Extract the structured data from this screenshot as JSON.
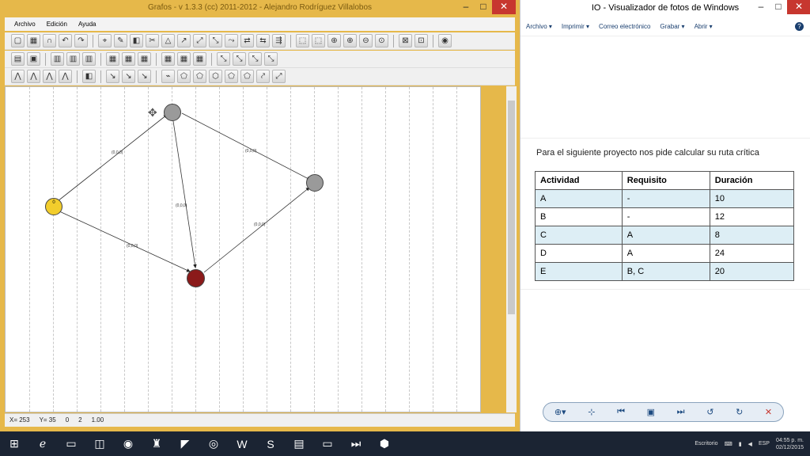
{
  "graphs_window": {
    "title": "Grafos - v 1.3.3 (cc) 2011-2012 - Alejandro Rodríguez Villalobos",
    "menu": [
      "Archivo",
      "Edición",
      "Ayuda"
    ],
    "status": {
      "x": "X= 253",
      "y": "Y= 35",
      "edges": "0",
      "count": "2",
      "zoom": "1.00"
    },
    "nodes": [
      {
        "label": "0",
        "color": "#f2cd2c"
      },
      {
        "label": "",
        "color": "#9a9a9a"
      },
      {
        "label": "",
        "color": "#9a9a9a"
      },
      {
        "label": "",
        "color": "#8b1a1a"
      }
    ],
    "edge_labels": [
      "(0,0,0)",
      "(0,0,0)",
      "(0,0,0)",
      "(0,0,0)",
      "(0,0,0)"
    ]
  },
  "viewer_window": {
    "title": "IO - Visualizador de fotos de Windows",
    "menu": [
      "Archivo ▾",
      "Imprimir ▾",
      "Correo electrónico",
      "Grabar ▾",
      "Abrir ▾"
    ],
    "help": "?",
    "photo_title": "Para el siguiente proyecto nos pide calcular su ruta crítica",
    "table": {
      "headers": [
        "Actividad",
        "Requisito",
        "Duración"
      ],
      "rows": [
        [
          "A",
          "-",
          "10"
        ],
        [
          "B",
          "-",
          "12"
        ],
        [
          "C",
          "A",
          "8"
        ],
        [
          "D",
          "A",
          "24"
        ],
        [
          "E",
          "B, C",
          "20"
        ]
      ]
    }
  },
  "taskbar": {
    "lang": "ESP",
    "time": "04:55 p. m.",
    "date": "02/12/2015",
    "desktop": "Escritorio"
  }
}
